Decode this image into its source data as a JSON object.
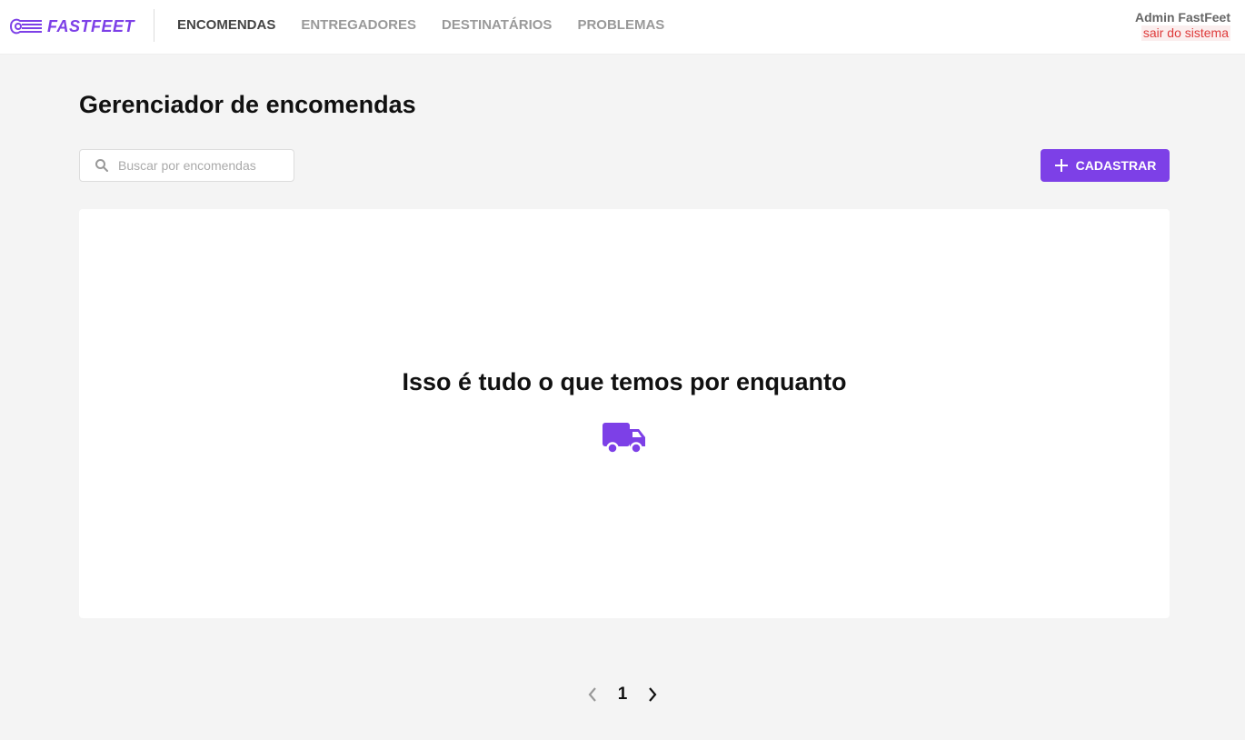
{
  "brand": {
    "name": "FASTFEET",
    "color": "#7d40e7"
  },
  "nav": {
    "items": [
      {
        "label": "ENCOMENDAS",
        "active": true
      },
      {
        "label": "ENTREGADORES",
        "active": false
      },
      {
        "label": "DESTINATÁRIOS",
        "active": false
      },
      {
        "label": "PROBLEMAS",
        "active": false
      }
    ]
  },
  "profile": {
    "name": "Admin FastFeet",
    "logout_label": "sair do sistema"
  },
  "page": {
    "title": "Gerenciador de encomendas"
  },
  "search": {
    "placeholder": "Buscar por encomendas",
    "value": "",
    "icon": "search-icon"
  },
  "actions": {
    "add_label": "CADASTRAR",
    "add_icon": "plus-icon"
  },
  "empty_state": {
    "message": "Isso é tudo o que temos por enquanto",
    "icon": "truck-icon"
  },
  "pagination": {
    "current_page": "1",
    "prev_icon": "chevron-left-icon",
    "next_icon": "chevron-right-icon"
  },
  "colors": {
    "accent": "#7d40e7",
    "danger": "#de3b3b",
    "background": "#f4f4f4"
  }
}
